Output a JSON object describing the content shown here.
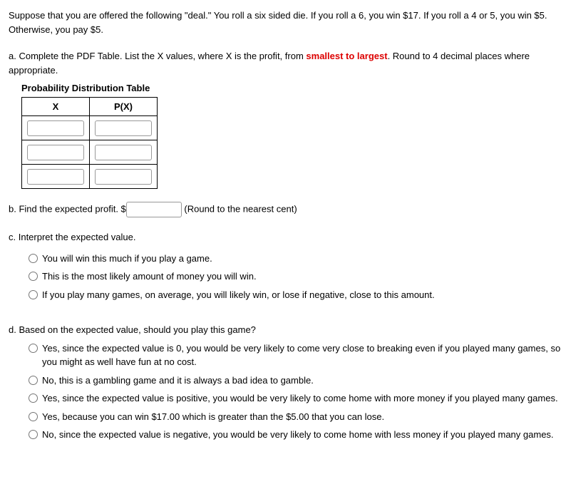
{
  "intro": "Suppose that you are offered the following \"deal.\" You roll a six sided die. If you roll a 6, you win $17. If you roll a 4 or 5, you win $5. Otherwise, you pay $5.",
  "partA": {
    "prefix": "a. Complete the PDF Table. List the X values, where X is the profit, from ",
    "highlight": "smallest to largest",
    "suffix": ". Round to 4 decimal places where appropriate.",
    "tableTitle": "Probability Distribution Table",
    "headers": {
      "x": "X",
      "px": "P(X)"
    }
  },
  "partB": {
    "prefix": "b. Find the expected profit. $",
    "suffix": " (Round to the nearest cent)"
  },
  "partC": {
    "label": "c. Interpret the expected value.",
    "options": [
      "You will win this much if you play a game.",
      "This is the most likely amount of money you will win.",
      "If you play many games, on average, you will likely win, or lose if negative, close to this amount."
    ]
  },
  "partD": {
    "label": "d. Based on the expected value, should you play this game?",
    "options": [
      "Yes, since the expected value is 0, you would be very likely to come very close to breaking even if you played many games, so you might as well have fun at no cost.",
      "No, this is a gambling game and it is always a bad idea to gamble.",
      "Yes, since the expected value is positive, you would be very likely to come home with more money if you played many games.",
      "Yes, because you can win $17.00 which is greater than the $5.00 that you can lose.",
      "No, since the expected value is negative, you would be very likely to come home with less money if you played many games."
    ]
  }
}
